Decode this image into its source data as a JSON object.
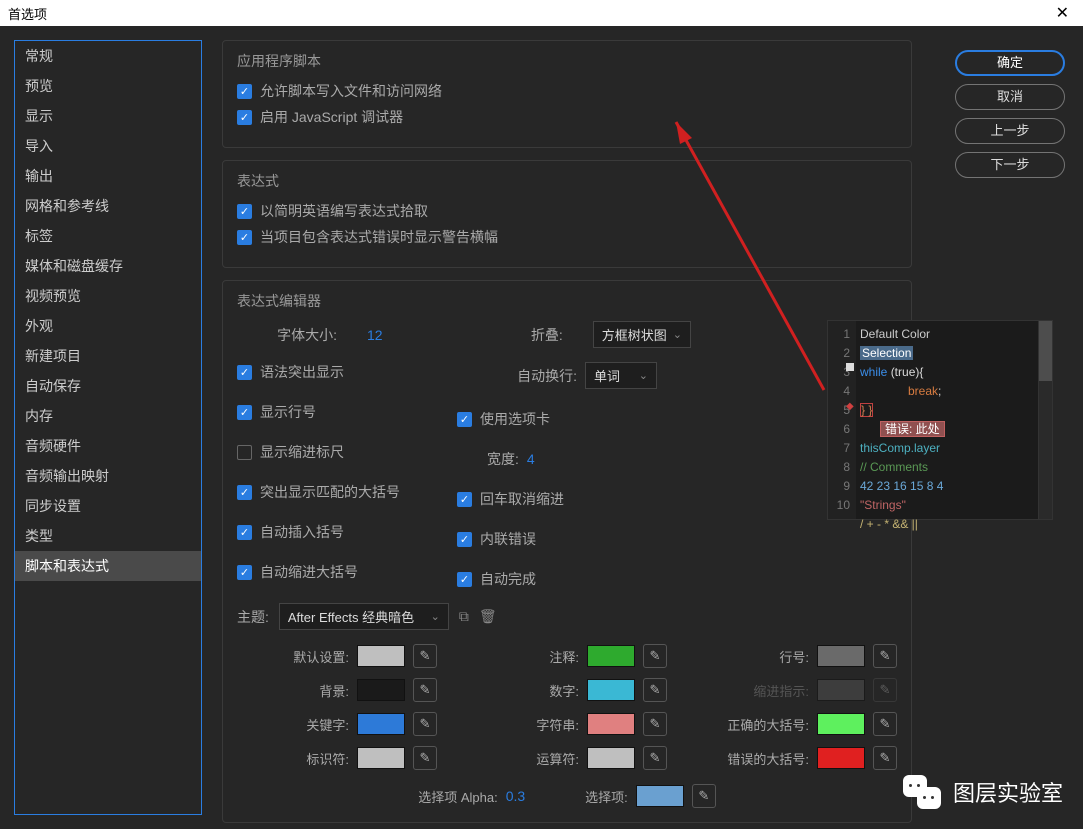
{
  "titlebar": {
    "title": "首选项"
  },
  "buttons": {
    "ok": "确定",
    "cancel": "取消",
    "prev": "上一步",
    "next": "下一步"
  },
  "sidebar": {
    "items": [
      "常规",
      "预览",
      "显示",
      "导入",
      "输出",
      "网格和参考线",
      "标签",
      "媒体和磁盘缓存",
      "视频预览",
      "外观",
      "新建项目",
      "自动保存",
      "内存",
      "音频硬件",
      "音频输出映射",
      "同步设置",
      "类型",
      "脚本和表达式"
    ],
    "selected": 17
  },
  "sections": {
    "app_script": {
      "title": "应用程序脚本",
      "allow_write": "允许脚本写入文件和访问网络",
      "enable_debugger": "启用 JavaScript 调试器"
    },
    "expression": {
      "title": "表达式",
      "plain_english": "以简明英语编写表达式拾取",
      "show_warning": "当项目包含表达式错误时显示警告横幅"
    },
    "editor": {
      "title": "表达式编辑器",
      "font_size_label": "字体大小:",
      "font_size": "12",
      "fold_label": "折叠:",
      "fold_value": "方框树状图",
      "wrap_label": "自动换行:",
      "wrap_value": "单词",
      "syntax_highlight": "语法突出显示",
      "show_line_num": "显示行号",
      "show_indent_ruler": "显示缩进标尺",
      "highlight_braces": "突出显示匹配的大括号",
      "auto_insert_brace": "自动插入括号",
      "auto_indent_brace": "自动缩进大括号",
      "use_tabs": "使用选项卡",
      "width_label": "宽度:",
      "width_value": "4",
      "enter_unindent": "回车取消缩进",
      "inline_errors": "内联错误",
      "auto_complete": "自动完成"
    },
    "theme": {
      "label": "主题:",
      "value": "After Effects 经典暗色",
      "colors": {
        "default": "默认设置:",
        "comment": "注释:",
        "lineno": "行号:",
        "background": "背景:",
        "number": "数字:",
        "indent": "缩进指示:",
        "keyword": "关键字:",
        "string": "字符串:",
        "correct_brace": "正确的大括号:",
        "identifier": "标识符:",
        "operator": "运算符:",
        "error_brace": "错误的大括号:",
        "alpha_label": "选择项 Alpha:",
        "alpha_value": "0.3",
        "selection": "选择项:"
      },
      "swatches": {
        "default": "#bfbfbf",
        "comment": "#2eaa2e",
        "lineno": "#6a6a6a",
        "background": "#1a1a1a",
        "number": "#3ab8d4",
        "indent": "#555555",
        "keyword": "#2d7ad8",
        "string": "#e08080",
        "correct_brace": "#5ef05e",
        "identifier": "#bfbfbf",
        "operator": "#bfbfbf",
        "error_brace": "#e02020",
        "selection": "#6aa0d0"
      }
    }
  },
  "code": {
    "line1": "Default Color",
    "line2": "Selection",
    "line3a": "while ",
    "line3b": "(true){",
    "line4": "break",
    "line4b": ";",
    "line5": "} }",
    "line5err": "错误: 此处",
    "line6": "thisComp.layer",
    "line7": "// Comments",
    "line8": "42 23 16 15 8 4",
    "line9": "\"Strings\"",
    "line10": "/ + - * && ||"
  },
  "watermark": "图层实验室"
}
